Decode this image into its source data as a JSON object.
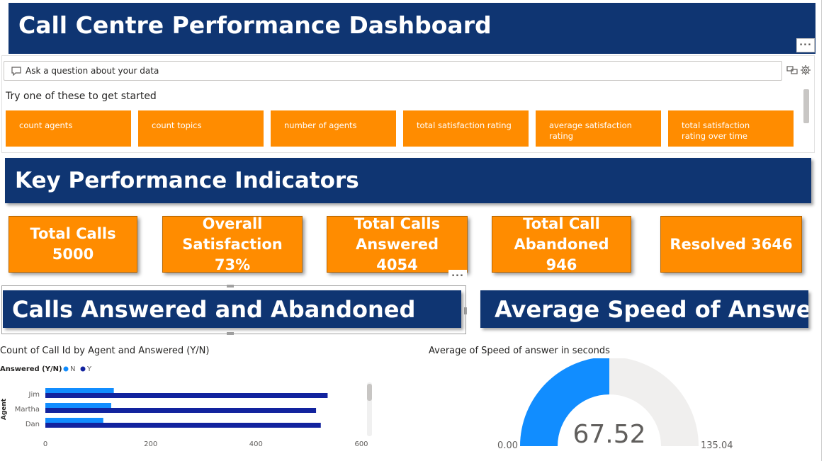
{
  "dashboard_title": "Call Centre Performance Dashboard",
  "qa": {
    "placeholder": "Ask a question about your data",
    "prompt": "Try one of these to get started",
    "suggestions": [
      "count agents",
      "count topics",
      "number of agents",
      "total satisfaction rating",
      "average satisfaction rating",
      "total satisfaction rating over time"
    ]
  },
  "kpi_section_title": "Key Performance Indicators",
  "kpis": [
    {
      "label": "Total Calls 5000"
    },
    {
      "label": "Overall Satisfaction 73%"
    },
    {
      "label": "Total Calls Answered 4054"
    },
    {
      "label": "Total Call Abandoned 946"
    },
    {
      "label": "Resolved 3646"
    }
  ],
  "section_answered_abandoned": "Calls Answered and Abandoned",
  "section_speed": "Average Speed of Answer",
  "more_options": "...",
  "colors": {
    "banner": "#0f3572",
    "kpi": "#ff8c00",
    "series_n": "#118dff",
    "series_y": "#12239e",
    "gauge_track": "#f0efee"
  },
  "chart_data": [
    {
      "type": "bar",
      "orientation": "horizontal",
      "title": "Count of Call Id by Agent and Answered (Y/N)",
      "legend_title": "Answered (Y/N)",
      "ylabel": "Agent",
      "categories": [
        "Jim",
        "Martha",
        "Dan"
      ],
      "series": [
        {
          "name": "N",
          "values": [
            130,
            125,
            110
          ]
        },
        {
          "name": "Y",
          "values": [
            536,
            514,
            523
          ]
        }
      ],
      "xlim": [
        0,
        600
      ],
      "xticks": [
        "0",
        "200",
        "400",
        "600"
      ],
      "legend_position": "top-left"
    },
    {
      "type": "gauge",
      "title": "Average of Speed of answer in seconds",
      "value": 67.52,
      "min": 0,
      "max": 135.04,
      "value_label": "67.52",
      "min_label": "0.00",
      "max_label": "135.04"
    }
  ]
}
